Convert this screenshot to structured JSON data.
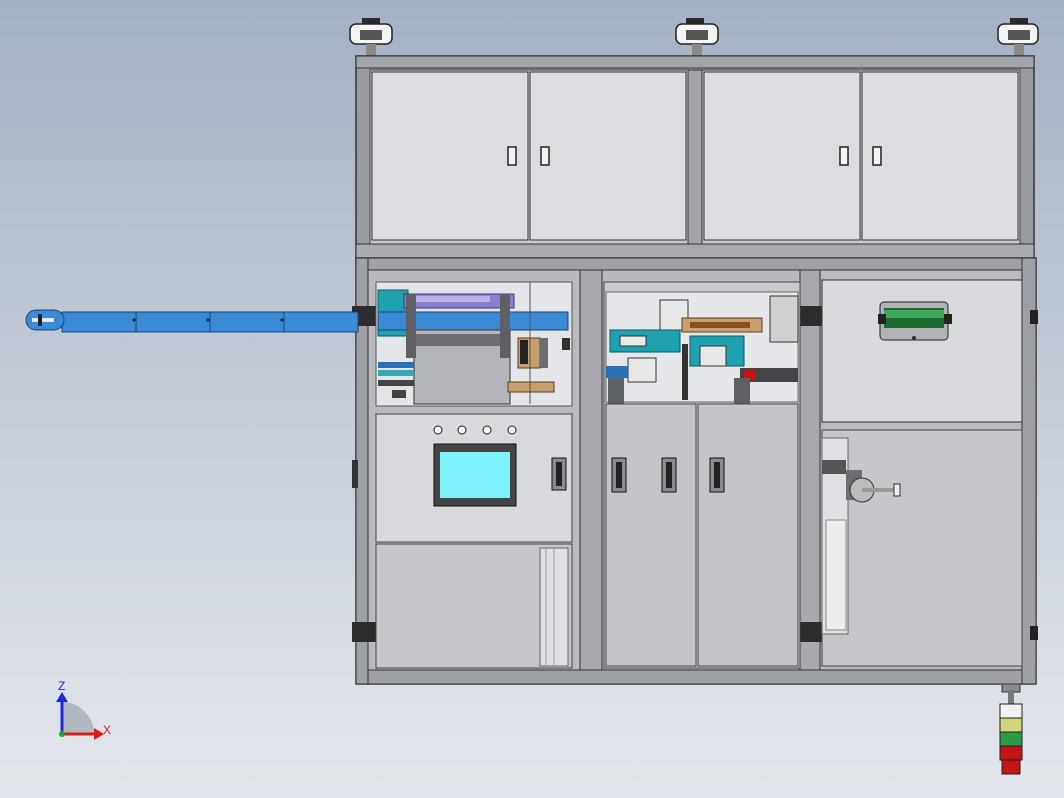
{
  "triad": {
    "z_label": "Z",
    "x_label": "X",
    "z_color": "#1c2bd8",
    "x_color": "#d81c1c",
    "y_color": "#1ca82c"
  },
  "colors": {
    "frame": "#8e9096",
    "frame_dark": "#4a4c52",
    "panel": "#d6d7da",
    "panel_light": "#e2e3e6",
    "conveyor": "#3a8ad6",
    "screen": "#7ff3fb",
    "teal": "#1fa2b0",
    "purple": "#8a7fd0",
    "tan": "#c8a070"
  },
  "icons": {
    "triad": "axis-triad-icon",
    "caster": "leveling-foot-icon",
    "signal_tower": "signal-tower-icon"
  },
  "signal_tower": {
    "lights": [
      "#f2f2f2",
      "#cfd77a",
      "#2e9a46",
      "#c41414"
    ]
  }
}
